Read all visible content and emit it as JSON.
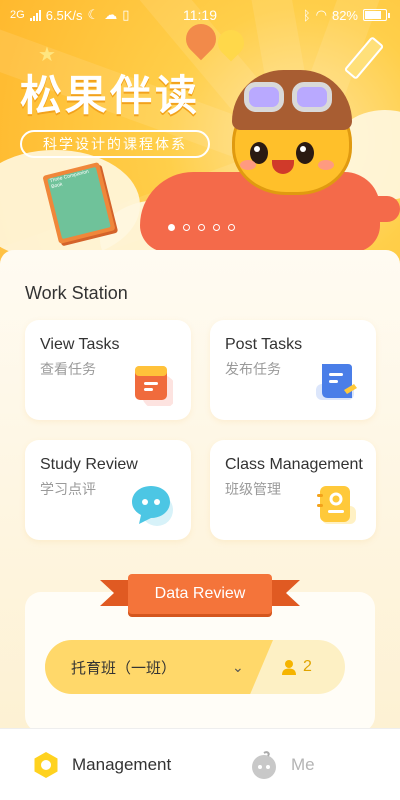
{
  "status_bar": {
    "network": "2G",
    "speed": "6.5K/s",
    "time": "11:19",
    "battery": "82%"
  },
  "banner": {
    "title": "松果伴读",
    "subtitle": "科学设计的课程体系",
    "book_title": "Three Companion Book",
    "slides": 5,
    "active_slide": 1
  },
  "work_station": {
    "title": "Work Station",
    "cards": [
      {
        "title": "View Tasks",
        "subtitle": "查看任务",
        "icon": "task-folder-icon",
        "color": "#f06b3c"
      },
      {
        "title": "Post Tasks",
        "subtitle": "发布任务",
        "icon": "post-document-icon",
        "color": "#4a7ee8"
      },
      {
        "title": "Study Review",
        "subtitle": "学习点评",
        "icon": "chat-bubble-icon",
        "color": "#4cc6e4"
      },
      {
        "title": "Class Management",
        "subtitle": "班级管理",
        "icon": "class-notebook-icon",
        "color": "#ffc93a"
      }
    ]
  },
  "data_review": {
    "title": "Data Review",
    "selected_class": "托育班（一班）",
    "student_count": "2"
  },
  "bottom_nav": {
    "items": [
      {
        "label": "Management",
        "active": true
      },
      {
        "label": "Me",
        "active": false
      }
    ]
  },
  "colors": {
    "banner": "#ffc73a",
    "accent_orange": "#f4743a",
    "page_bg": "#fdf3d9"
  }
}
